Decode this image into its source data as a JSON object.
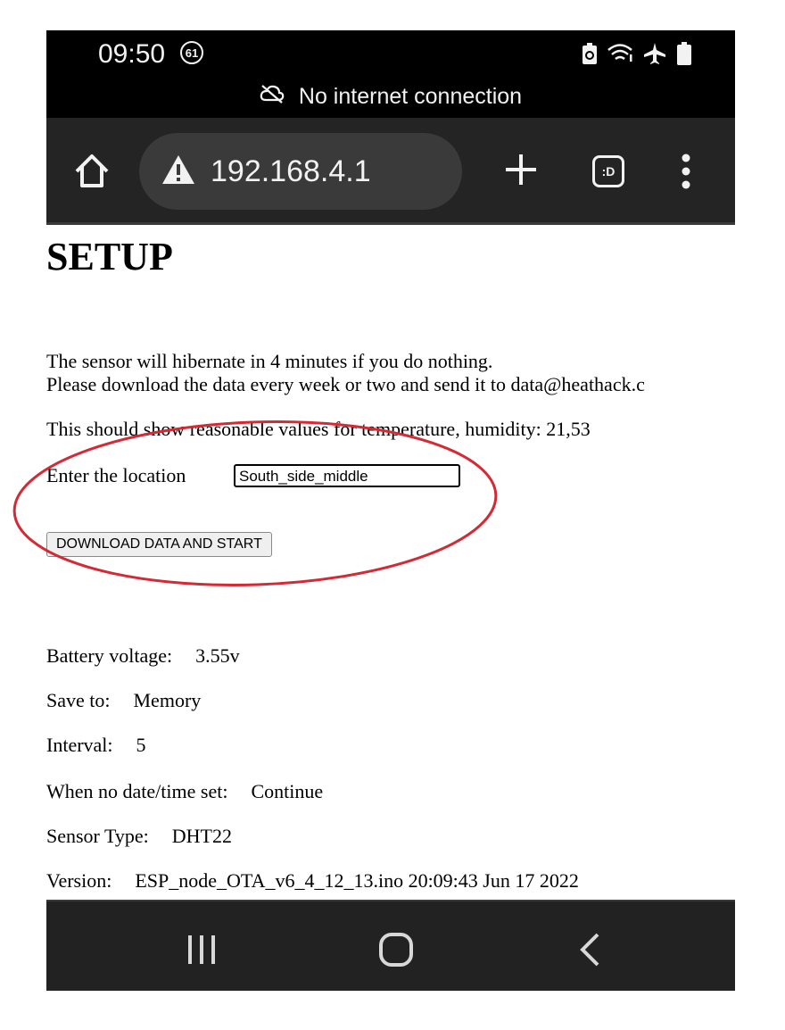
{
  "status_bar": {
    "time": "09:50",
    "notification_count": "61",
    "offline_text": "No internet connection"
  },
  "browser": {
    "url": "192.168.4.1",
    "tab_label": ":D"
  },
  "page": {
    "title": "SETUP",
    "hibernate_text": "The sensor will hibernate in 4 minutes if you do nothing.",
    "download_text": "Please download the data every week or two and send it to data@heathack.c",
    "reading_text": "This should show reasonable values for temperature, humidity: 21,53",
    "location_label": "Enter the location",
    "location_value": "South_side_middle",
    "download_button": "DOWNLOAD DATA AND START",
    "info": [
      {
        "label": "Battery voltage:",
        "value": "3.55v"
      },
      {
        "label": "Save to:",
        "value": "Memory"
      },
      {
        "label": "Interval:",
        "value": "5"
      },
      {
        "label": "When no date/time set:",
        "value": "Continue"
      },
      {
        "label": "Sensor Type:",
        "value": "DHT22"
      },
      {
        "label": "Version:",
        "value": "ESP_node_OTA_v6_4_12_13.ino 20:09:43 Jun 17 2022"
      }
    ]
  },
  "icons": {
    "home": "home-icon",
    "warning": "warning-icon",
    "new_tab": "plus-icon",
    "menu": "more-vert-icon",
    "cloud_off": "cloud-off-icon",
    "nav_recent": "recent-apps-icon",
    "nav_home": "nav-home-icon",
    "nav_back": "back-icon"
  },
  "colors": {
    "annotation": "#d42a35",
    "toolbar": "#242424",
    "statusbar": "#000000"
  }
}
